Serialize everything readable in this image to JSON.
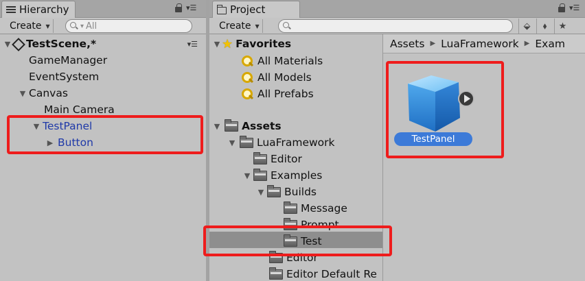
{
  "hierarchy": {
    "tab_title": "Hierarchy",
    "create_label": "Create",
    "search_placeholder": "All",
    "scene_name": "TestScene,*",
    "items": [
      {
        "label": "GameManager"
      },
      {
        "label": "EventSystem"
      },
      {
        "label": "Canvas"
      },
      {
        "label": "Main Camera"
      },
      {
        "label": "TestPanel"
      },
      {
        "label": "Button"
      }
    ]
  },
  "project": {
    "tab_title": "Project",
    "create_label": "Create",
    "search_placeholder": "",
    "favorites": {
      "label": "Favorites",
      "items": [
        {
          "label": "All Materials"
        },
        {
          "label": "All Models"
        },
        {
          "label": "All Prefabs"
        }
      ]
    },
    "assets": {
      "label": "Assets",
      "items": [
        {
          "label": "LuaFramework"
        },
        {
          "label": "Editor"
        },
        {
          "label": "Examples"
        },
        {
          "label": "Builds"
        },
        {
          "label": "Message"
        },
        {
          "label": "Prompt"
        },
        {
          "label": "Test"
        },
        {
          "label": "Editor"
        },
        {
          "label": "Editor Default Re"
        }
      ]
    },
    "breadcrumb": [
      "Assets",
      "LuaFramework",
      "Exam"
    ],
    "asset_grid": [
      {
        "name": "TestPanel",
        "icon": "prefab-cube-icon"
      }
    ]
  },
  "colors": {
    "highlight": "#ee1c1c",
    "selection": "#3c7ad8",
    "child_text": "#1f39a8"
  }
}
